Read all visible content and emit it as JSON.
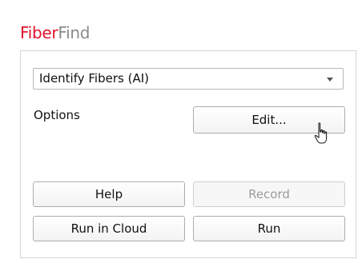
{
  "header": {
    "title_part1": "Fiber",
    "title_part2": "Find",
    "colors": {
      "brand_red": "#e0142b",
      "brand_gray": "#8a8a8a"
    }
  },
  "panel": {
    "dropdown": {
      "selected": "Identify Fibers (AI)"
    },
    "options_label": "Options",
    "edit_button": "Edit...",
    "help_button": "Help",
    "record_button": "Record",
    "run_cloud_button": "Run in Cloud",
    "run_button": "Run"
  },
  "cursor": {
    "icon": "hand-pointer-icon"
  }
}
